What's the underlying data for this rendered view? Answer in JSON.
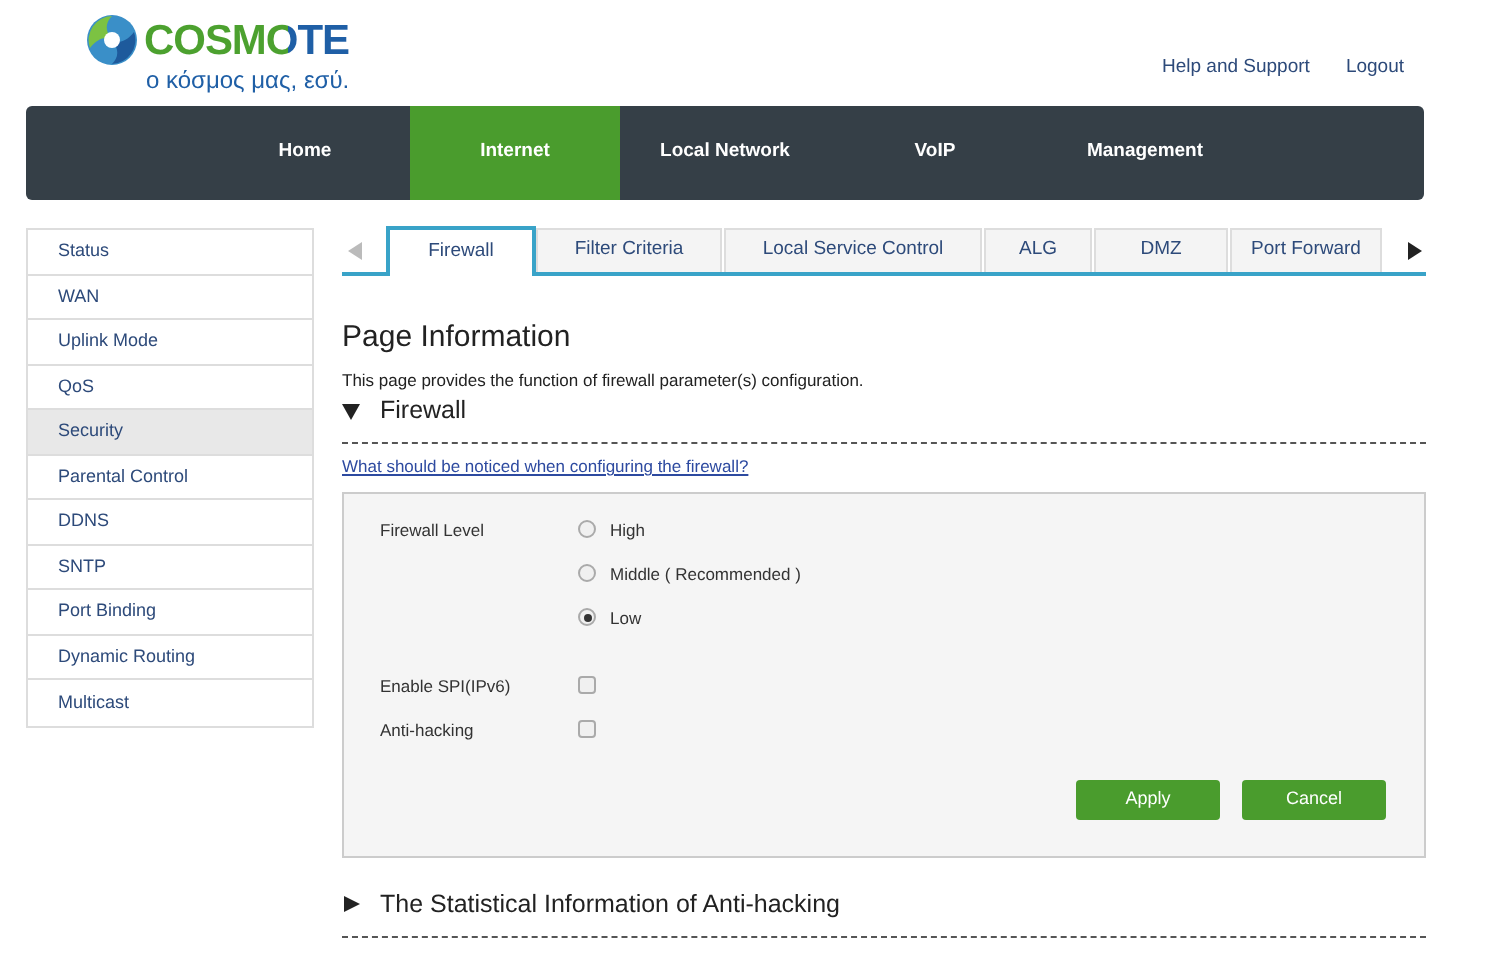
{
  "header": {
    "logo_text": "COSMOTE",
    "tagline": "ο κόσμος μας, εσύ.",
    "links": [
      "Help and Support",
      "Logout"
    ]
  },
  "nav": [
    {
      "label": "Home",
      "selected": false
    },
    {
      "label": "Internet",
      "selected": true
    },
    {
      "label": "Local Network",
      "selected": false
    },
    {
      "label": "VoIP",
      "selected": false
    },
    {
      "label": "Management",
      "selected": false
    }
  ],
  "sidebar": {
    "items": [
      {
        "label": "Status",
        "selected": false
      },
      {
        "label": "WAN",
        "selected": false
      },
      {
        "label": "Uplink Mode",
        "selected": false
      },
      {
        "label": "QoS",
        "selected": false
      },
      {
        "label": "Security",
        "selected": true
      },
      {
        "label": "Parental Control",
        "selected": false
      },
      {
        "label": "DDNS",
        "selected": false
      },
      {
        "label": "SNTP",
        "selected": false
      },
      {
        "label": "Port Binding",
        "selected": false
      },
      {
        "label": "Dynamic Routing",
        "selected": false
      },
      {
        "label": "Multicast",
        "selected": false
      }
    ]
  },
  "tabs": {
    "prev_disabled": true,
    "next_disabled": false,
    "items": [
      {
        "label": "Firewall",
        "selected": true
      },
      {
        "label": "Filter Criteria",
        "selected": false
      },
      {
        "label": "Local Service Control",
        "selected": false
      },
      {
        "label": "ALG",
        "selected": false
      },
      {
        "label": "DMZ",
        "selected": false
      },
      {
        "label": "Port Forward",
        "selected": false
      }
    ]
  },
  "page_info": {
    "title": "Page Information",
    "description": "This page provides the function of firewall parameter(s) configuration."
  },
  "firewall_section": {
    "title": "Firewall",
    "expanded": true,
    "help_link": "What should be noticed when configuring the firewall?",
    "level_label": "Firewall Level",
    "levels": [
      {
        "label": "High",
        "selected": false
      },
      {
        "label": "Middle ( Recommended )",
        "selected": false
      },
      {
        "label": "Low",
        "selected": true
      }
    ],
    "checkboxes": [
      {
        "label": "Enable SPI(IPv6)",
        "checked": false
      },
      {
        "label": "Anti-hacking",
        "checked": false
      }
    ],
    "buttons": [
      "Apply",
      "Cancel"
    ]
  },
  "stats_section": {
    "title": "The Statistical Information of Anti-hacking",
    "expanded": false
  }
}
